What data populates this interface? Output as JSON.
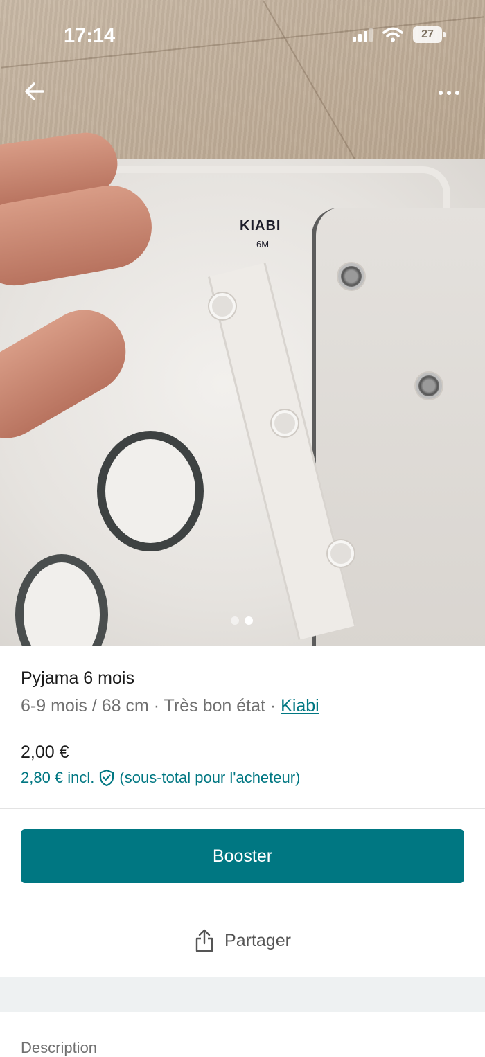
{
  "status_bar": {
    "time": "17:14",
    "battery": "27",
    "signal_icon": "cellular-signal-icon",
    "wifi_icon": "wifi-icon"
  },
  "photo": {
    "brand_label": "KIABI",
    "size_label": "6M",
    "page_count": 2,
    "current_page": 2
  },
  "nav": {
    "back_icon": "arrow-left-icon",
    "more_icon": "more-horizontal-icon"
  },
  "item": {
    "title": "Pyjama 6 mois",
    "size": "6-9 mois / 68 cm",
    "separator": " · ",
    "condition": "Très bon état",
    "brand": "Kiabi",
    "price": "2,00 €",
    "price_incl": "2,80 € incl.",
    "price_incl_note": "(sous-total pour l'acheteur)",
    "protection_icon": "shield-check-icon"
  },
  "actions": {
    "booster_label": "Booster",
    "share_label": "Partager",
    "share_icon": "share-icon"
  },
  "description": {
    "heading": "Description"
  },
  "colors": {
    "accent": "#007782",
    "text_secondary": "#707070"
  }
}
